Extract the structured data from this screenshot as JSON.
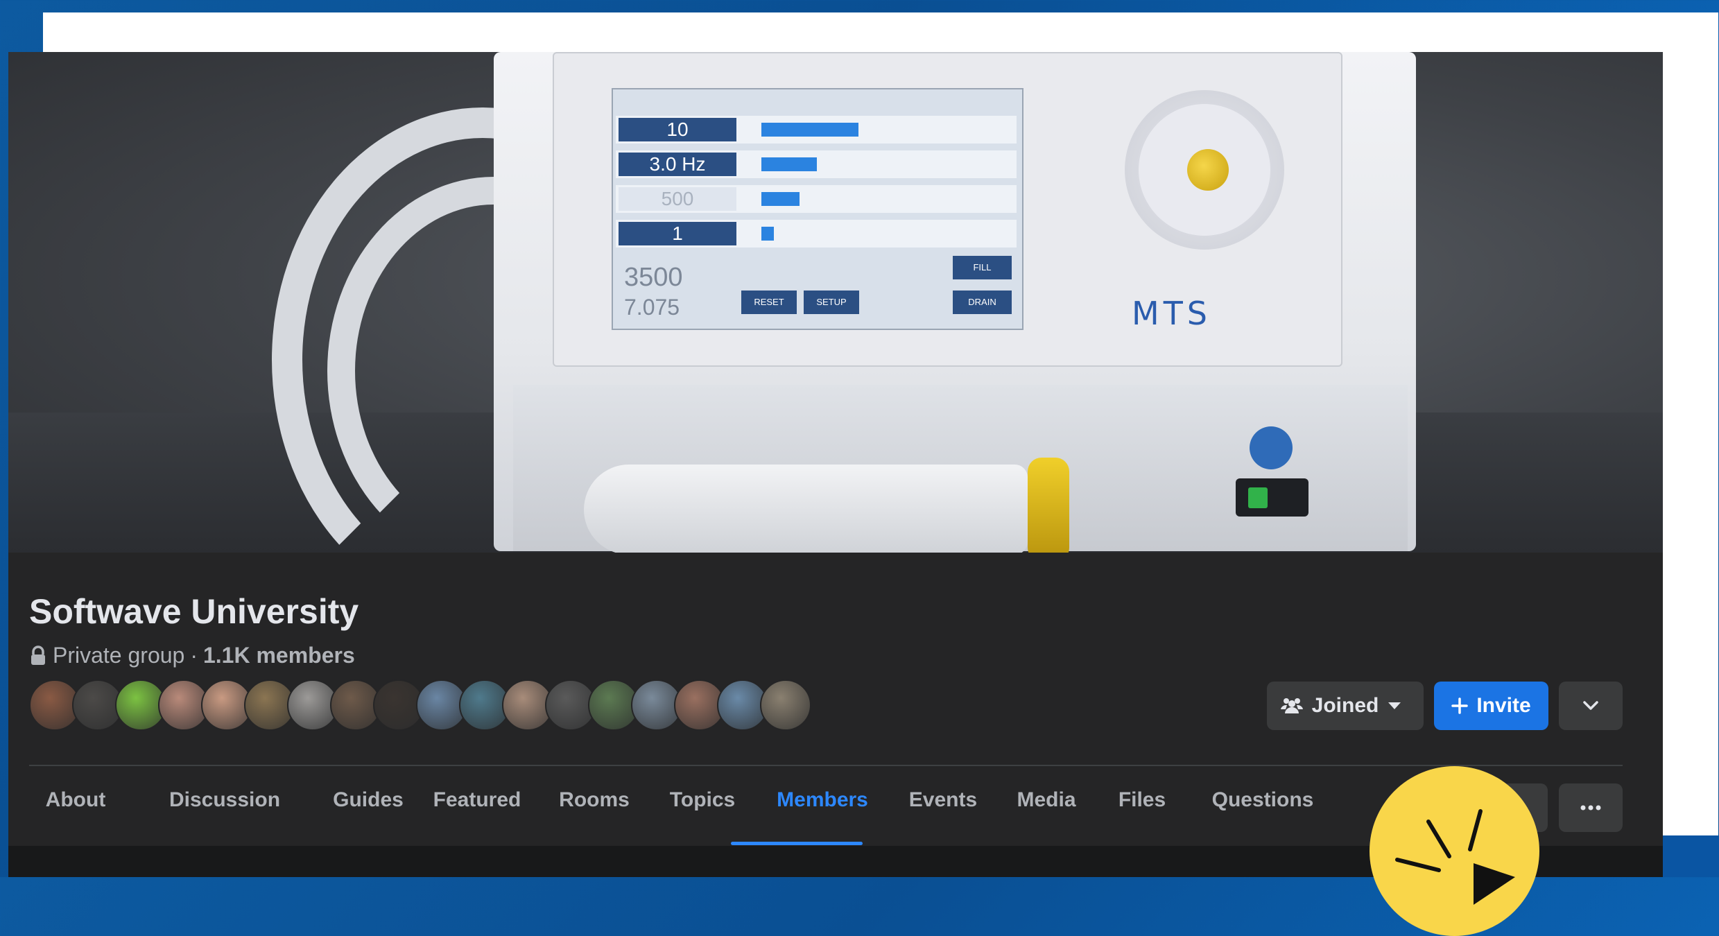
{
  "cover": {
    "screen_rows": [
      "10",
      "3.0 Hz",
      "500",
      "1"
    ],
    "screen_totals": [
      "3500",
      "7.075"
    ],
    "screen_buttons": [
      "RESET",
      "SETUP",
      "FILL",
      "DRAIN"
    ],
    "brand": "MTS"
  },
  "group": {
    "name": "Softwave University",
    "privacy": "Private group",
    "separator": "·",
    "members_count": "1.1K members",
    "avatar_colors": [
      "#8a5a44",
      "#4c4a48",
      "#7cc242",
      "#b98a7a",
      "#c99a82",
      "#8b7552",
      "#9c9a98",
      "#6e5a4a",
      "#3a3430",
      "#6a86a4",
      "#4f7a8c",
      "#a88c7a",
      "#5a5a5a",
      "#5c7a52",
      "#7a8a9a",
      "#9a7060",
      "#6a8aa8",
      "#8a8070"
    ],
    "primary_color": "#1b74e4"
  },
  "actions": {
    "joined_label": "Joined",
    "invite_label": "Invite",
    "more_icon": "chevron-down-icon"
  },
  "tabs": [
    {
      "label": "About"
    },
    {
      "label": "Discussion"
    },
    {
      "label": "Guides"
    },
    {
      "label": "Featured"
    },
    {
      "label": "Rooms"
    },
    {
      "label": "Topics"
    },
    {
      "label": "Members",
      "active": true
    },
    {
      "label": "Events"
    },
    {
      "label": "Media"
    },
    {
      "label": "Files"
    },
    {
      "label": "Questions"
    }
  ],
  "tab_actions": {
    "ellipsis_icon": "ellipsis-icon",
    "active_color": "#2d88ff"
  }
}
